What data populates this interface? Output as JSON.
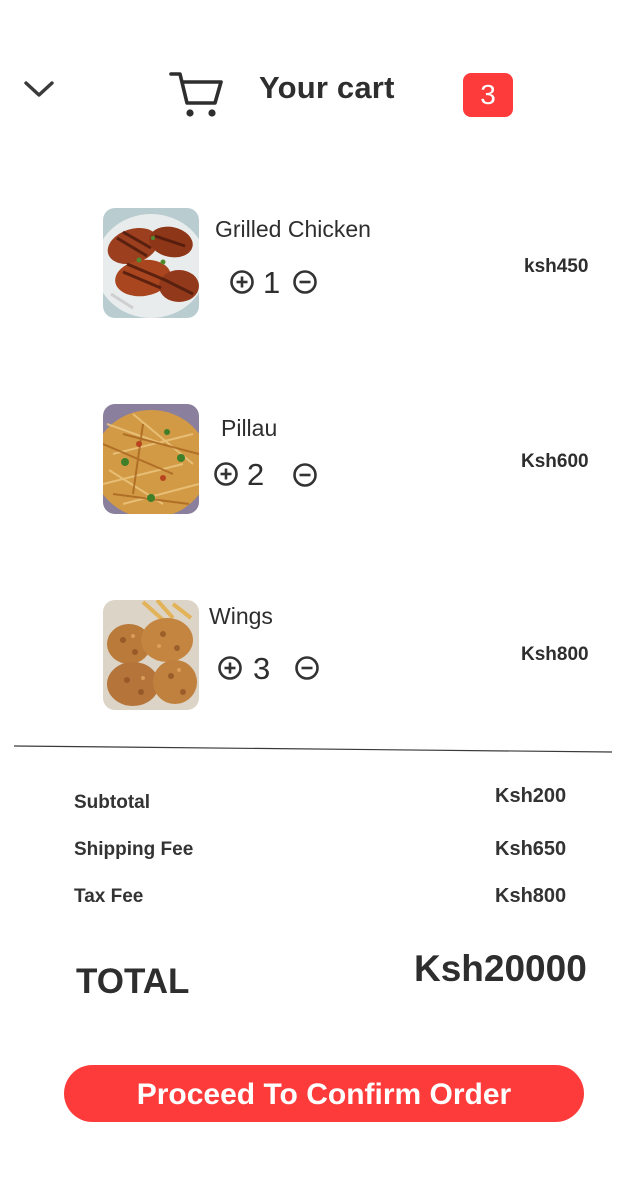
{
  "header": {
    "collapse_icon": "chevron-down-icon",
    "cart_icon": "shopping-cart-icon",
    "title": "Your cart",
    "badge_count": "3"
  },
  "items": [
    {
      "name": "Grilled Chicken",
      "qty": "1",
      "price": "ksh450",
      "image": "grilled-chicken-photo"
    },
    {
      "name": "Pillau",
      "qty": "2",
      "price": "Ksh600",
      "image": "pillau-photo"
    },
    {
      "name": "Wings",
      "qty": "3",
      "price": "Ksh800",
      "image": "wings-photo"
    }
  ],
  "summary": {
    "subtotal_label": "Subtotal",
    "subtotal_value": "Ksh200",
    "shipping_label": "Shipping Fee",
    "shipping_value": "Ksh650",
    "tax_label": "Tax Fee",
    "tax_value": "Ksh800",
    "total_label": "TOTAL",
    "total_value": "Ksh20000"
  },
  "cta": {
    "label": "Proceed To Confirm Order"
  },
  "colors": {
    "accent": "#fd3b3b",
    "text": "#2e2e2e"
  }
}
